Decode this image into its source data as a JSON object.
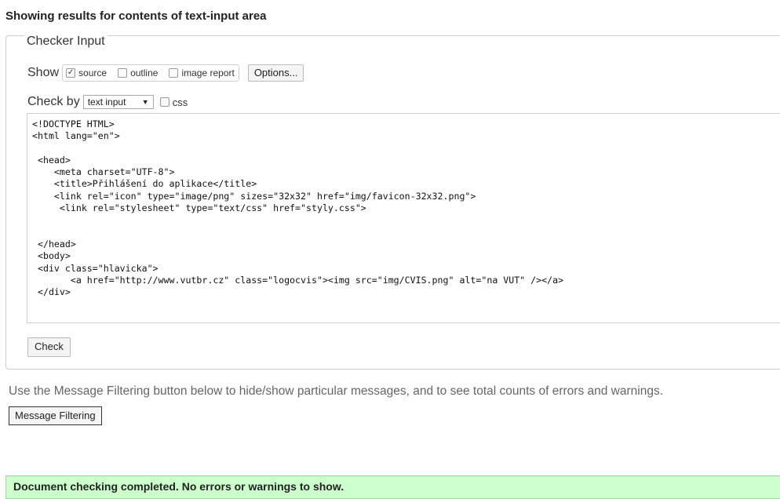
{
  "page": {
    "heading": "Showing results for contents of text-input area"
  },
  "checker": {
    "legend": "Checker Input",
    "show_label": "Show",
    "show_options": [
      {
        "label": "source",
        "checked": true
      },
      {
        "label": "outline",
        "checked": false
      },
      {
        "label": "image report",
        "checked": false
      }
    ],
    "options_button": "Options...",
    "check_by_label": "Check by",
    "check_by_value": "text input",
    "css_label": "css",
    "css_checked": false,
    "source_lines": [
      "<!DOCTYPE HTML>",
      "<html lang=\"en\">",
      "",
      " <head>",
      "    <meta charset=\"UTF-8\">",
      "    <title>Přihlášení do aplikace</title>",
      "    <link rel=\"icon\" type=\"image/png\" sizes=\"32x32\" href=\"img/favicon-32x32.png\">",
      "     <link rel=\"stylesheet\" type=\"text/css\" href=\"styly.css\">",
      "",
      "",
      " </head>",
      " <body>",
      " <div class=\"hlavicka\">",
      "       <a href=\"http://www.vutbr.cz\" class=\"logocvis\"><img src=\"img/CVIS.png\" alt=\"na VUT\" /></a>",
      " </div>"
    ],
    "check_button": "Check"
  },
  "filtering": {
    "info_text": "Use the Message Filtering button below to hide/show particular messages, and to see total counts of errors and warnings.",
    "button_label": "Message Filtering"
  },
  "status": {
    "text": "Document checking completed. No errors or warnings to show.",
    "color": "#ccffcc"
  }
}
